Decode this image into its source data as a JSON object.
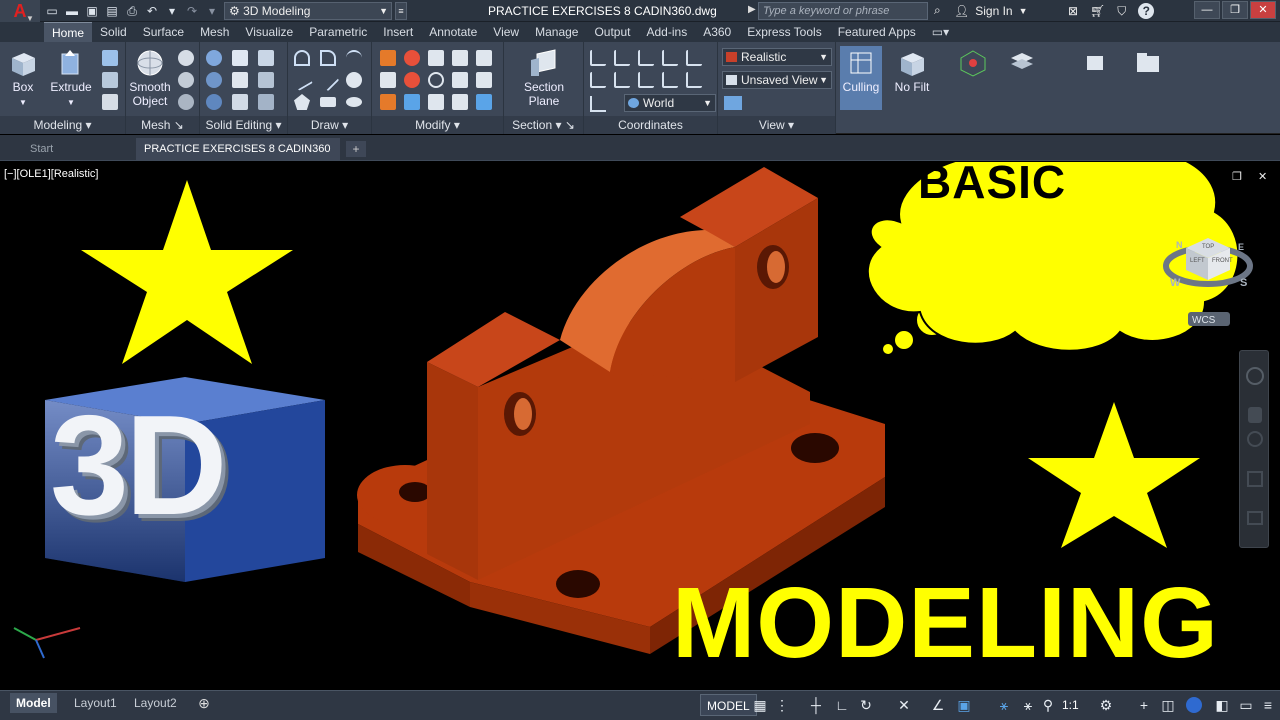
{
  "titlebar": {
    "app_letter": "A",
    "workspace": "3D Modeling",
    "document_title": "PRACTICE EXERCISES 8 CADIN360.dwg",
    "search_placeholder": "Type a keyword or phrase",
    "signin": "Sign In"
  },
  "ribbon_tabs": [
    "Home",
    "Solid",
    "Surface",
    "Mesh",
    "Visualize",
    "Parametric",
    "Insert",
    "Annotate",
    "View",
    "Manage",
    "Output",
    "Add-ins",
    "A360",
    "Express Tools",
    "Featured Apps"
  ],
  "ribbon": {
    "box_label": "Box",
    "extrude_label": "Extrude",
    "smooth_object_label": "Smooth Object",
    "section_plane_label": "Section Plane",
    "visual_style": "Realistic",
    "view_combo": "Unsaved View",
    "ucs_combo": "World",
    "culling_label": "Culling",
    "no_filter_label": "No Filt",
    "panels": {
      "modeling": "Modeling",
      "mesh": "Mesh",
      "solid_editing": "Solid Editing",
      "draw": "Draw",
      "modify": "Modify",
      "section": "Section",
      "coordinates": "Coordinates",
      "view": "View"
    }
  },
  "file_tabs": {
    "start": "Start",
    "active": "PRACTICE EXERCISES 8 CADIN360"
  },
  "viewport": {
    "label": "[−][OLE1][Realistic]",
    "viewcube_faces": [
      "LEFT",
      "FRONT",
      "TOP"
    ],
    "compass": [
      "W",
      "S",
      "N",
      "E"
    ],
    "wcs": "WCS"
  },
  "overlay": {
    "cube_text": "3D",
    "bubble_text": "BASIC",
    "modeling_text": "MODELING"
  },
  "layout_tabs": [
    "Model",
    "Layout1",
    "Layout2"
  ],
  "status": {
    "model": "MODEL",
    "scale": "1:1"
  },
  "colors": {
    "accent_yellow": "#ffff00",
    "part_orange": "#b83a0c",
    "ribbon_bg": "#3d4757",
    "cube_blue": "#2a4fa8"
  }
}
